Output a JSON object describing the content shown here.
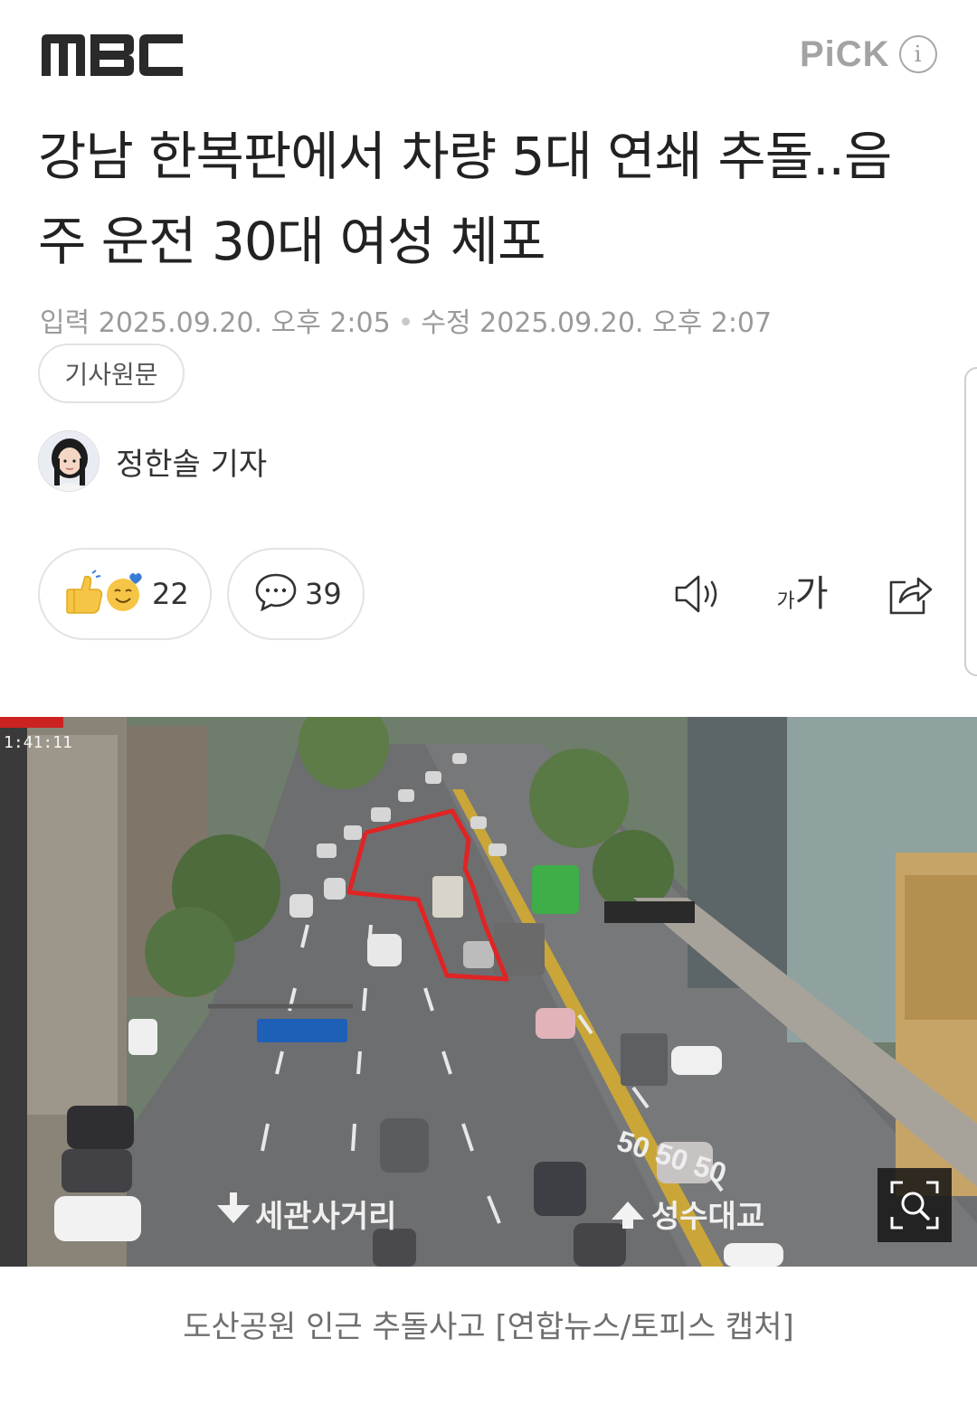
{
  "header": {
    "brand": "MBC",
    "pick_label": "PiCK",
    "info_icon": "i"
  },
  "article": {
    "title": "강남 한복판에서 차량 5대 연쇄 추돌..음주 운전 30대 여성 체포",
    "input_label": "입력",
    "input_time": "2025.09.20. 오후 2:05",
    "edit_label": "수정",
    "edit_time": "2025.09.20. 오후 2:07",
    "original_button": "기사원문",
    "reporter": "정한솔 기자"
  },
  "actions": {
    "reaction_count": "22",
    "comment_count": "39",
    "font_small": "가",
    "font_large": "가"
  },
  "photo": {
    "timestamp": "1:41:11",
    "road_sign_left": "세관사거리",
    "road_sign_right": "성수대교",
    "road_marking": "50 50 50",
    "caption": "도산공원 인근 추돌사고 [연합뉴스/토피스 캡처]"
  },
  "icons": [
    "mbc-logo",
    "info-icon",
    "thumbs-up-icon",
    "smile-heart-icon",
    "comment-icon",
    "speaker-icon",
    "font-size-icon",
    "share-icon",
    "zoom-search-icon"
  ],
  "colors": {
    "highlight_outline": "#e02424",
    "bus_green": "#3fae49",
    "sign_blue": "#1e5fb8"
  }
}
